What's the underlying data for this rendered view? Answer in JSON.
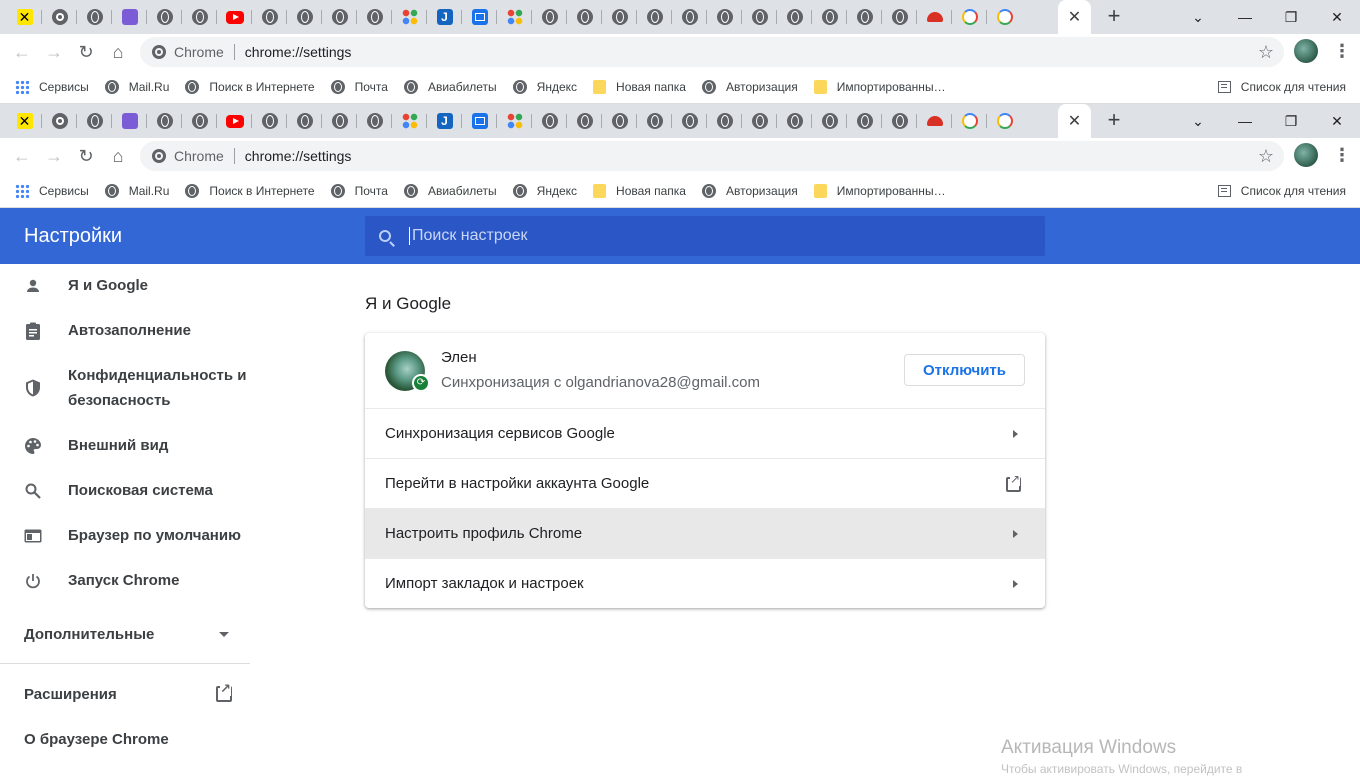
{
  "tabs": {
    "favicons": [
      "raiffeisen",
      "chrome",
      "globe",
      "radio",
      "globe",
      "globe",
      "youtube",
      "globe",
      "globe",
      "globe",
      "globe",
      "apps",
      "j",
      "mail",
      "apps",
      "globe",
      "globe",
      "globe",
      "globe",
      "globe",
      "globe",
      "globe",
      "globe",
      "globe",
      "globe",
      "globe",
      "umbrella",
      "google",
      "google",
      "close"
    ],
    "active_close": "✕",
    "new_tab": "+"
  },
  "window": {
    "dropdown": "⌄",
    "minimize": "—",
    "restore": "❐",
    "close": "✕"
  },
  "toolbar": {
    "back": "←",
    "forward": "→",
    "reload": "↻",
    "home": "⌂",
    "omni_host": "Chrome",
    "omni_url": "chrome://settings",
    "star": "☆",
    "menu": "⋮"
  },
  "bookmarks": {
    "items": [
      {
        "label": "Сервисы",
        "icon": "apps-icon"
      },
      {
        "label": "Mail.Ru",
        "icon": "globe-icon"
      },
      {
        "label": "Поиск в Интернете",
        "icon": "globe-icon"
      },
      {
        "label": "Почта",
        "icon": "globe-icon"
      },
      {
        "label": "Авиабилеты",
        "icon": "globe-icon"
      },
      {
        "label": "Яндекс",
        "icon": "globe-icon"
      },
      {
        "label": "Новая папка",
        "icon": "folder-icon"
      },
      {
        "label": "Авторизация",
        "icon": "globe-icon"
      },
      {
        "label": "Импортированны…",
        "icon": "folder-icon"
      }
    ],
    "reading_list": "Список для чтения"
  },
  "settings": {
    "title": "Настройки",
    "search_placeholder": "Поиск настроек",
    "sidebar": {
      "items": [
        {
          "label": "Я и Google",
          "icon": "person-icon"
        },
        {
          "label": "Автозаполнение",
          "icon": "clipboard-icon"
        },
        {
          "label": "Конфиденциальность и безопасность",
          "icon": "shield-icon"
        },
        {
          "label": "Внешний вид",
          "icon": "palette-icon"
        },
        {
          "label": "Поисковая система",
          "icon": "search-icon"
        },
        {
          "label": "Браузер по умолчанию",
          "icon": "browser-icon"
        },
        {
          "label": "Запуск Chrome",
          "icon": "power-icon"
        }
      ],
      "advanced": "Дополнительные",
      "extensions": "Расширения",
      "about": "О браузере Chrome"
    },
    "section_title": "Я и Google",
    "account": {
      "name": "Элен",
      "sync_status": "Синхронизация с olgandrianova28@gmail.com",
      "disconnect": "Отключить"
    },
    "rows": [
      {
        "label": "Синхронизация сервисов Google",
        "trail": "arrow"
      },
      {
        "label": "Перейти в настройки аккаунта Google",
        "trail": "external"
      },
      {
        "label": "Настроить профиль Chrome",
        "trail": "arrow"
      },
      {
        "label": "Импорт закладок и настроек",
        "trail": "arrow"
      }
    ]
  },
  "watermark": {
    "title": "Активация Windows",
    "subtitle": "Чтобы активировать Windows, перейдите в"
  },
  "colors": {
    "header": "#3367d6",
    "search": "#2a56c6",
    "accent": "#1a73e8",
    "sync_badge": "#188038"
  }
}
